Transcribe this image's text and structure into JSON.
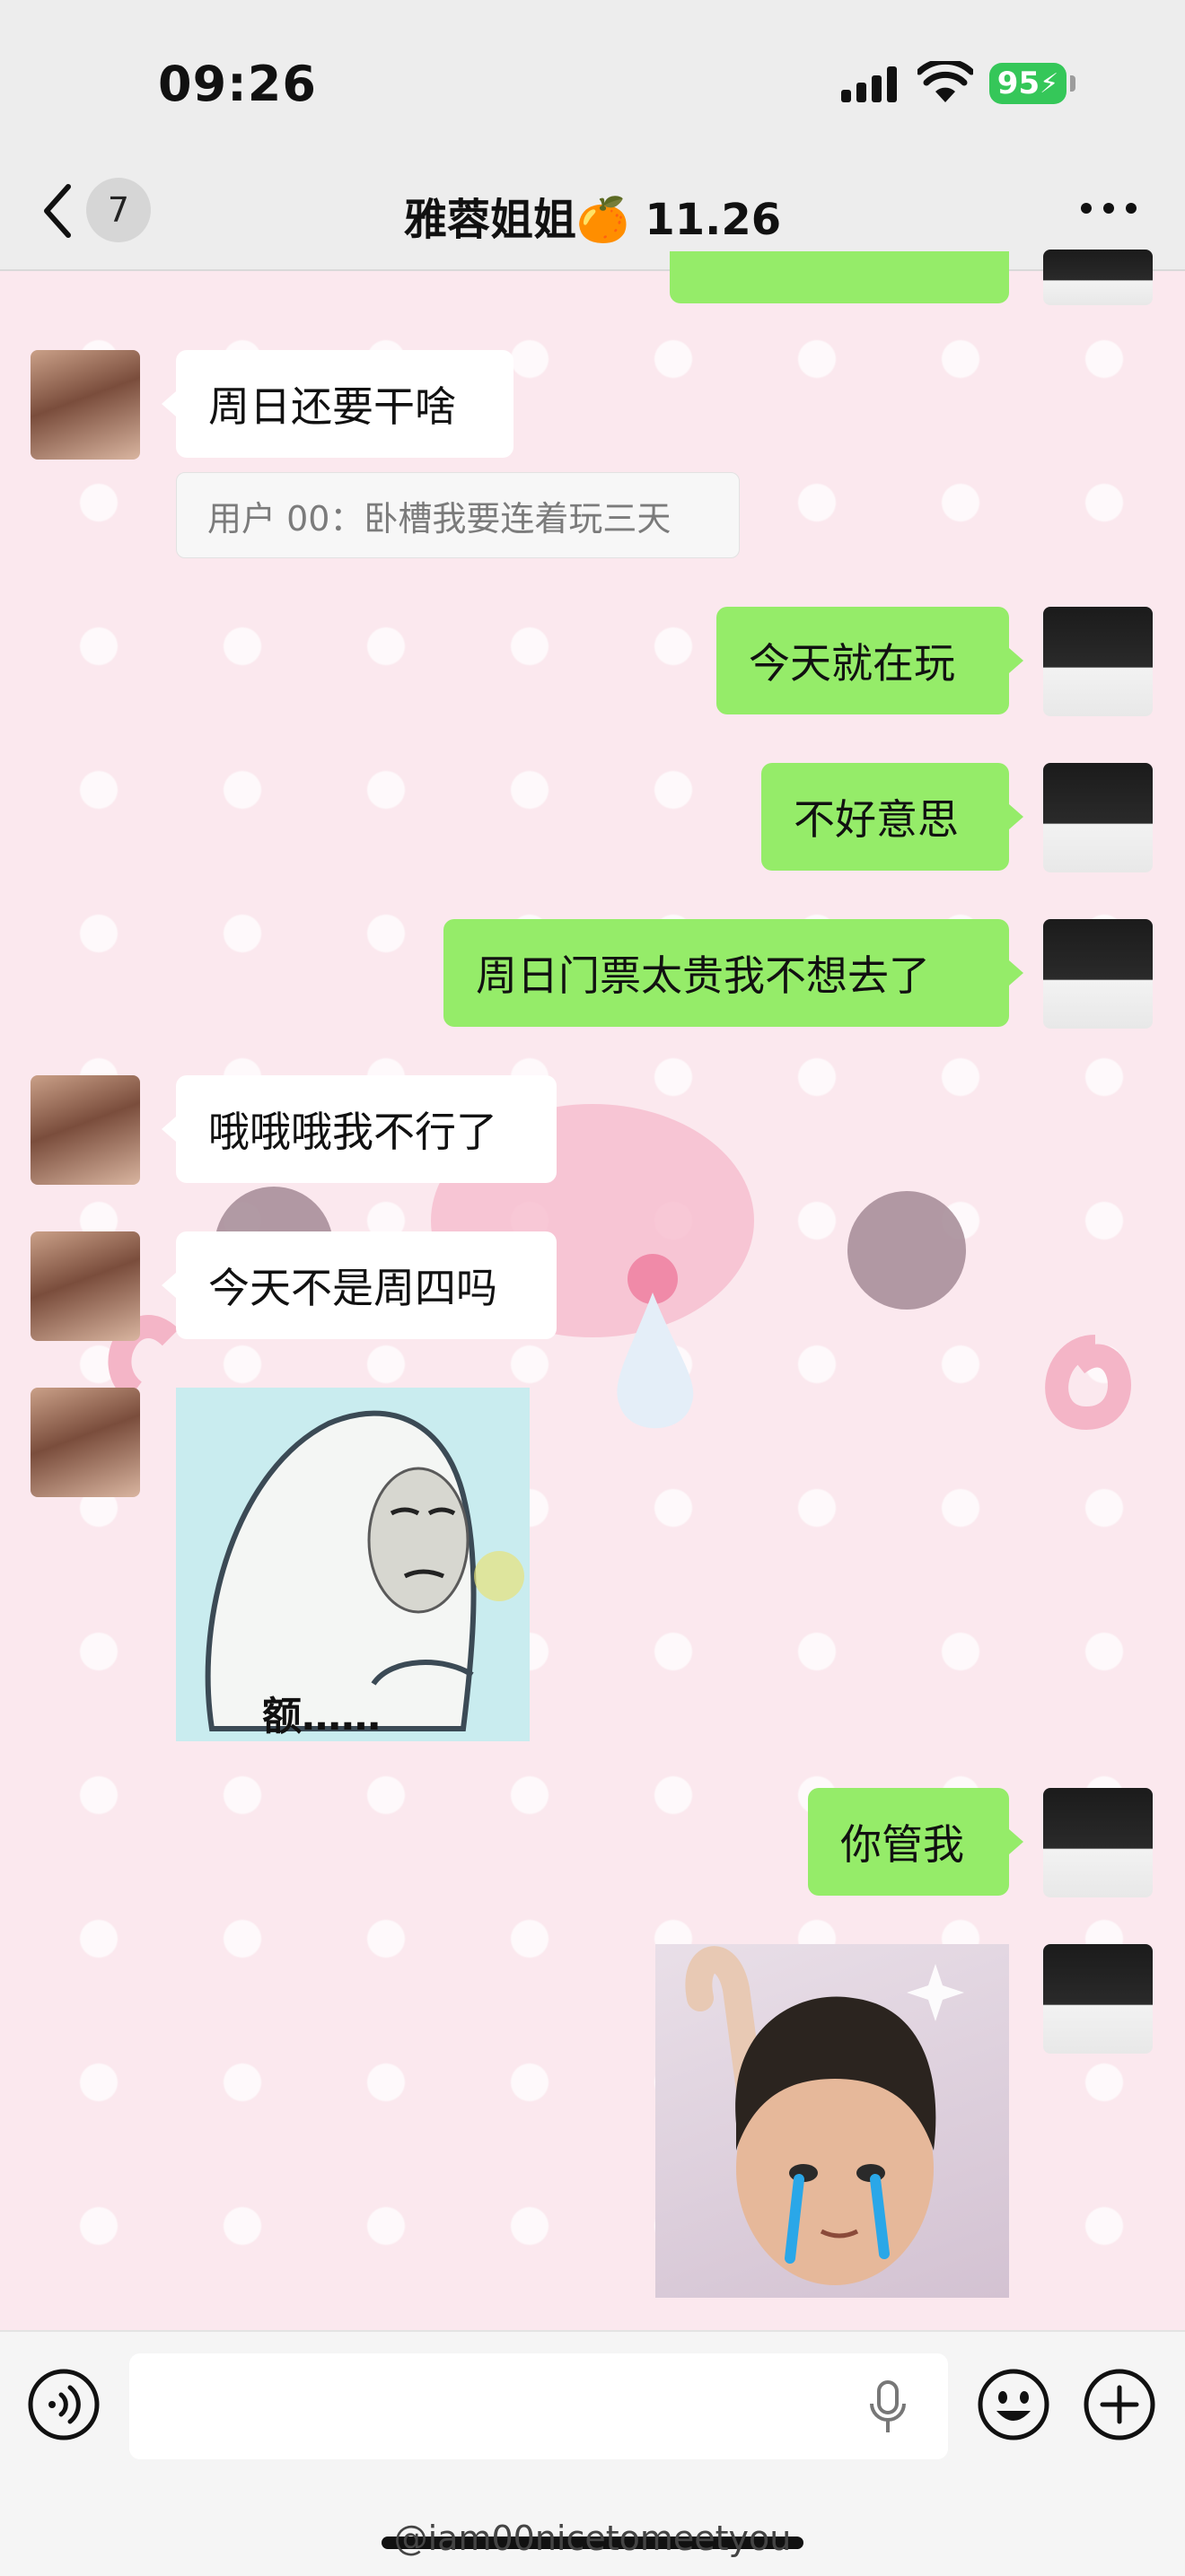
{
  "status_bar": {
    "time": "09:26",
    "battery": "95"
  },
  "nav": {
    "unread_count": "7",
    "title": "雅蓉姐姐🍊 11.26"
  },
  "messages": [
    {
      "text": "周日还要干啥"
    },
    {
      "quote": "用户 00：卧槽我要连着玩三天"
    },
    {
      "text": "今天就在玩"
    },
    {
      "text": "不好意思"
    },
    {
      "text": "周日门票太贵我不想去了"
    },
    {
      "text": "哦哦哦我不行了"
    },
    {
      "text": "今天不是周四吗"
    },
    {
      "sticker_caption": "额……"
    },
    {
      "text": "你管我"
    }
  ],
  "watermark": "@iam00nicetomeetyou",
  "colors": {
    "outgoing_bubble": "#95ec69",
    "incoming_bubble": "#ffffff",
    "chat_background": "#fbe8ee"
  }
}
